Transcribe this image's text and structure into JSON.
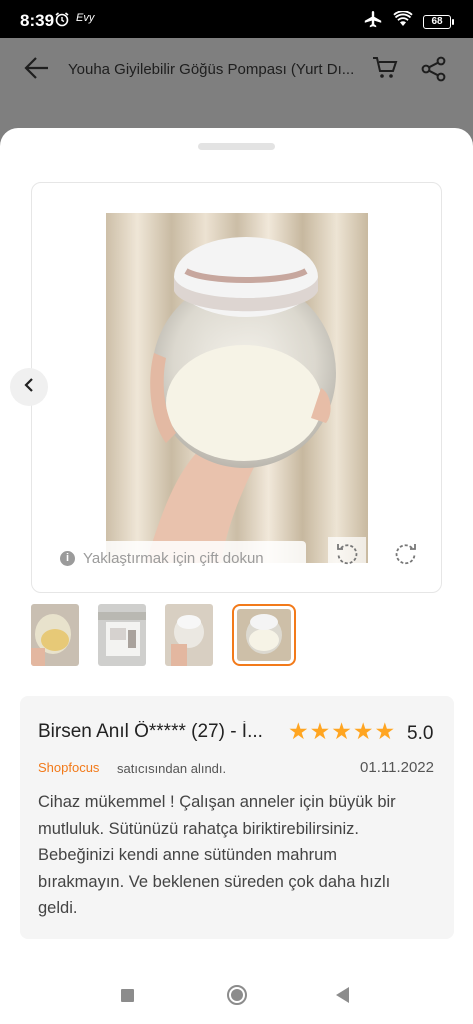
{
  "status_bar": {
    "time": "8:39",
    "carrier": "Evy",
    "battery": "68"
  },
  "app_bar": {
    "title": "Youha Giyilebilir Göğüs Pompası (Yurt Dı..."
  },
  "viewer": {
    "hint": "Yaklaştırmak için çift dokun"
  },
  "thumbnails": {
    "count": 4,
    "active_index": 3
  },
  "review": {
    "reviewer": "Birsen Anıl Ö***** (27) - İ...",
    "rating": 5,
    "score": "5.0",
    "seller": "Shopfocus",
    "seller_suffix": "satıcısından alındı.",
    "date": "01.11.2022",
    "text": "Cihaz mükemmel ! Çalışan anneler için büyük bir mutluluk. Sütünüzü rahatça biriktirebilirsiniz. Bebeğinizi kendi anne sütünden mahrum bırakmayın. Ve beklenen süreden çok daha hızlı geldi."
  },
  "colors": {
    "accent": "#f27a1a",
    "star": "#ffa521",
    "review_bg": "#f5f5f5"
  }
}
